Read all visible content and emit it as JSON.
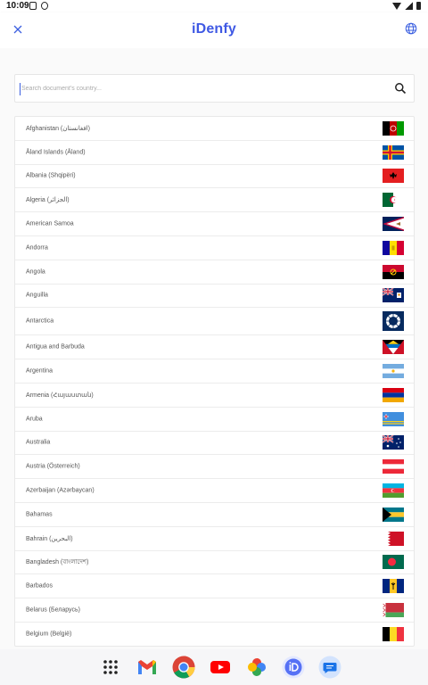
{
  "status_bar": {
    "time": "10:09"
  },
  "app_bar": {
    "title": "iDenfy"
  },
  "search": {
    "placeholder": "Search document's country..."
  },
  "countries": [
    {
      "name": "Afghanistan (افغانستان)",
      "flag": "af"
    },
    {
      "name": "Åland Islands (Åland)",
      "flag": "ax"
    },
    {
      "name": "Albania (Shqipëri)",
      "flag": "al"
    },
    {
      "name": "Algeria (الجزائر)",
      "flag": "dz"
    },
    {
      "name": "American Samoa",
      "flag": "as"
    },
    {
      "name": "Andorra",
      "flag": "ad"
    },
    {
      "name": "Angola",
      "flag": "ao"
    },
    {
      "name": "Anguilla",
      "flag": "ai"
    },
    {
      "name": "Antarctica",
      "flag": "aq"
    },
    {
      "name": "Antigua and Barbuda",
      "flag": "ag"
    },
    {
      "name": "Argentina",
      "flag": "ar"
    },
    {
      "name": "Armenia (Հայաստան)",
      "flag": "am"
    },
    {
      "name": "Aruba",
      "flag": "aw"
    },
    {
      "name": "Australia",
      "flag": "au"
    },
    {
      "name": "Austria (Österreich)",
      "flag": "at"
    },
    {
      "name": "Azerbaijan (Azərbaycan)",
      "flag": "az"
    },
    {
      "name": "Bahamas",
      "flag": "bs"
    },
    {
      "name": "Bahrain (البحرين)",
      "flag": "bh"
    },
    {
      "name": "Bangladesh (বাংলাদেশ)",
      "flag": "bd"
    },
    {
      "name": "Barbados",
      "flag": "bb"
    },
    {
      "name": "Belarus (Беларусь)",
      "flag": "by"
    },
    {
      "name": "Belgium (België)",
      "flag": "be"
    }
  ],
  "dock": [
    "apps-grid-icon",
    "gmail-icon",
    "chrome-icon",
    "youtube-icon",
    "photos-icon",
    "idenfy-app-icon",
    "messages-icon"
  ],
  "colors": {
    "brand": "#3f59e4",
    "background": "#fafafa"
  }
}
